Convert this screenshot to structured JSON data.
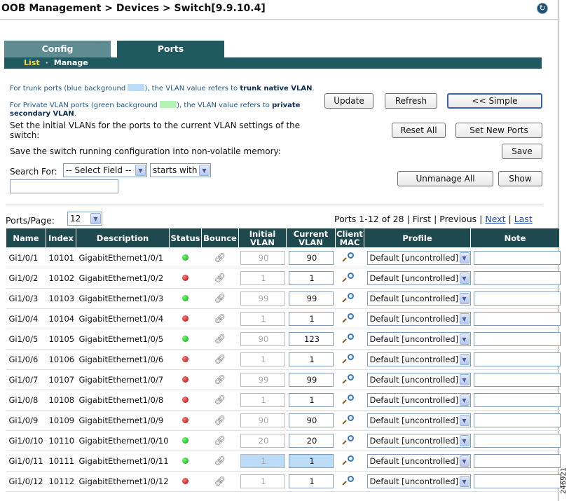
{
  "breadcrumb": "OOB Management > Devices > Switch[9.9.10.4]",
  "tabs": [
    {
      "label": "Config"
    },
    {
      "label": "Ports"
    }
  ],
  "subnav": {
    "list": "List",
    "manage": "Manage"
  },
  "info": {
    "trunk_prefix": "For trunk ports (blue background",
    "trunk_mid": "), the VLAN value refers to",
    "trunk_bold": "trunk native VLAN",
    "pvlan_prefix": "For Private VLAN ports (green background",
    "pvlan_mid": "), the VLAN value refers to",
    "pvlan_bold": "private secondary VLAN",
    "trunk_color": "#bcdbf7",
    "pvlan_color": "#b2f2b2"
  },
  "buttons": {
    "update": "Update",
    "refresh": "Refresh",
    "simple": "<< Simple",
    "reset_all": "Reset All",
    "set_new_ports": "Set New Ports",
    "save": "Save",
    "unmanage_all": "Unmanage All",
    "show": "Show"
  },
  "texts": {
    "initial_vlans": "Set the initial VLANs for the ports to the current VLAN settings of the switch:",
    "save_config": "Save the switch running configuration into non-volatile memory:",
    "search_for": "Search For:",
    "field_select": "-- Select Field --",
    "match_select": "starts with",
    "ports_per_page": "Ports/Page:",
    "ports_per_page_value": "12"
  },
  "pager": {
    "summary": "Ports 1-12 of 28",
    "first": "First",
    "previous": "Previous",
    "next": "Next",
    "last": "Last"
  },
  "columns": {
    "name": "Name",
    "index": "Index",
    "description": "Description",
    "status": "Status",
    "bounce": "Bounce",
    "initial_vlan_1": "Initial",
    "initial_vlan_2": "VLAN",
    "current_vlan_1": "Current",
    "current_vlan_2": "VLAN",
    "client_mac_1": "Client",
    "client_mac_2": "MAC",
    "profile": "Profile",
    "note": "Note"
  },
  "rows": [
    {
      "name": "Gi1/0/1",
      "index": "10101",
      "description": "GigabitEthernet1/0/1",
      "status": "up",
      "initial": "90",
      "current": "90",
      "profile": "Default [uncontrolled]"
    },
    {
      "name": "Gi1/0/2",
      "index": "10102",
      "description": "GigabitEthernet1/0/2",
      "status": "down",
      "initial": "1",
      "current": "1",
      "profile": "Default [uncontrolled]"
    },
    {
      "name": "Gi1/0/3",
      "index": "10103",
      "description": "GigabitEthernet1/0/3",
      "status": "up",
      "initial": "99",
      "current": "99",
      "profile": "Default [uncontrolled]"
    },
    {
      "name": "Gi1/0/4",
      "index": "10104",
      "description": "GigabitEthernet1/0/4",
      "status": "down",
      "initial": "1",
      "current": "1",
      "profile": "Default [uncontrolled]"
    },
    {
      "name": "Gi1/0/5",
      "index": "10105",
      "description": "GigabitEthernet1/0/5",
      "status": "up",
      "initial": "90",
      "current": "123",
      "profile": "Default [uncontrolled]"
    },
    {
      "name": "Gi1/0/6",
      "index": "10106",
      "description": "GigabitEthernet1/0/6",
      "status": "down",
      "initial": "1",
      "current": "1",
      "profile": "Default [uncontrolled]"
    },
    {
      "name": "Gi1/0/7",
      "index": "10107",
      "description": "GigabitEthernet1/0/7",
      "status": "down",
      "initial": "99",
      "current": "99",
      "profile": "Default [uncontrolled]"
    },
    {
      "name": "Gi1/0/8",
      "index": "10108",
      "description": "GigabitEthernet1/0/8",
      "status": "down",
      "initial": "1",
      "current": "1",
      "profile": "Default [uncontrolled]"
    },
    {
      "name": "Gi1/0/9",
      "index": "10109",
      "description": "GigabitEthernet1/0/9",
      "status": "down",
      "initial": "90",
      "current": "90",
      "profile": "Default [uncontrolled]"
    },
    {
      "name": "Gi1/0/10",
      "index": "10110",
      "description": "GigabitEthernet1/0/10",
      "status": "up",
      "initial": "20",
      "current": "20",
      "profile": "Default [uncontrolled]"
    },
    {
      "name": "Gi1/0/11",
      "index": "10111",
      "description": "GigabitEthernet1/0/11",
      "status": "up",
      "initial": "1",
      "current": "1",
      "profile": "Default [uncontrolled]",
      "trunk": true
    },
    {
      "name": "Gi1/0/12",
      "index": "10112",
      "description": "GigabitEthernet1/0/12",
      "status": "down",
      "initial": "1",
      "current": "1",
      "profile": "Default [uncontrolled]"
    }
  ],
  "icons": {
    "help": "refresh-help-icon",
    "bounce": "bounce-icon",
    "client_mac": "magnifier-icon"
  },
  "figure_id": "246921"
}
